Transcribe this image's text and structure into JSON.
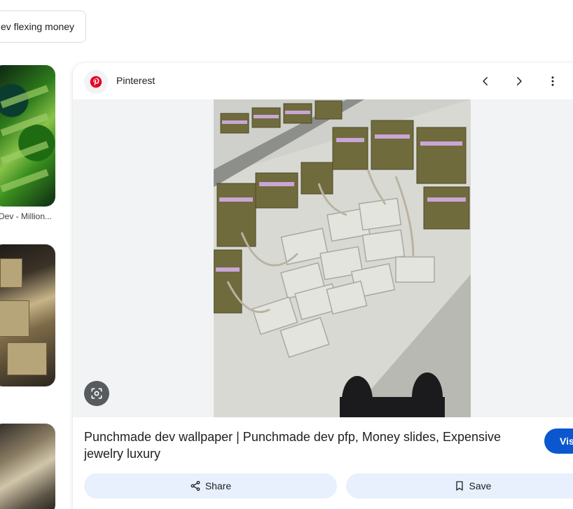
{
  "search_chip": {
    "label": "ev flexing money"
  },
  "sidebar": {
    "thumb1_caption": "Dev - Million..."
  },
  "panel": {
    "source_name": "Pinterest",
    "title": "Punchmade dev wallpaper | Punchmade dev pfp, Money slides, Expensive jewelry luxury",
    "visit_label": "Visit",
    "share_label": "Share",
    "save_label": "Save"
  },
  "colors": {
    "pinterest_red": "#e60023",
    "visit_blue": "#0b57d0",
    "action_bg": "#e8f0fe"
  },
  "icons": [
    "pinterest-icon",
    "chevron-left-icon",
    "chevron-right-icon",
    "more-vert-icon",
    "lens-icon",
    "share-icon",
    "bookmark-icon"
  ]
}
